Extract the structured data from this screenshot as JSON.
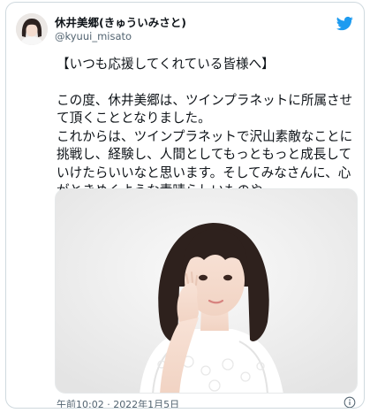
{
  "tweet": {
    "display_name": "休井美郷(きゅういみさと)",
    "handle": "@kyuui_misato",
    "body_lines": [
      "【いつも応援してくれている皆様へ】",
      "",
      "この度、休井美郷は、ツインプラネットに所属させて頂くこととなりました。",
      "これからは、ツインプラネットで沢山素敵なことに挑戦し、経験し、人間としてもっともっと成長していけたらいいなと思います。そしてみなさんに、心がときめくような素晴らしいものや、"
    ],
    "timestamp": "午前10:02 · 2022年1月5日"
  },
  "icons": {
    "brand": "twitter-bird-icon",
    "info": "info-icon"
  },
  "colors": {
    "brand_blue": "#1d9bf0",
    "secondary_text": "#536471",
    "border": "#cfd9de"
  }
}
